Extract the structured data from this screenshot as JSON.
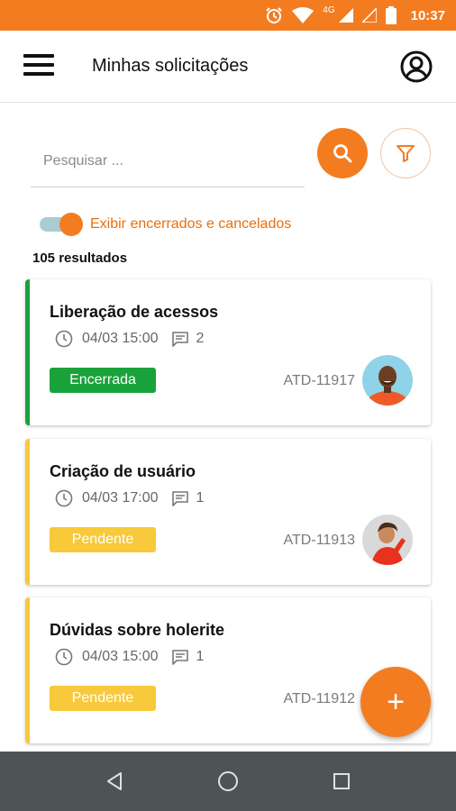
{
  "status_bar": {
    "time": "10:37",
    "network": "4G",
    "icons": [
      "alarm-icon",
      "wifi-icon",
      "signal-icon",
      "signal-empty-icon",
      "battery-icon"
    ]
  },
  "app_bar": {
    "title": "Minhas solicitações",
    "icons": [
      "menu-icon",
      "account-circle-icon"
    ]
  },
  "search": {
    "placeholder": "Pesquisar ..."
  },
  "toggle": {
    "label": "Exibir encerrados e cancelados",
    "checked": true
  },
  "results": {
    "count_label": "105 resultados"
  },
  "requests": [
    {
      "title": "Liberação de acessos",
      "datetime": "04/03 15:00",
      "comments": "2",
      "status": "Encerrada",
      "status_color": "#1aa23a",
      "ticket": "ATD-11917"
    },
    {
      "title": "Criação de usuário",
      "datetime": "04/03 17:00",
      "comments": "1",
      "status": "Pendente",
      "status_color": "#f7c93b",
      "ticket": "ATD-11913"
    },
    {
      "title": "Dúvidas sobre holerite",
      "datetime": "04/03 15:00",
      "comments": "1",
      "status": "Pendente",
      "status_color": "#f7c93b",
      "ticket": "ATD-11912"
    }
  ],
  "fab": {
    "label": "+"
  },
  "colors": {
    "accent": "#f47c20",
    "closed": "#1aa23a",
    "pending": "#f7c93b",
    "nav_bar": "#4e5356"
  }
}
